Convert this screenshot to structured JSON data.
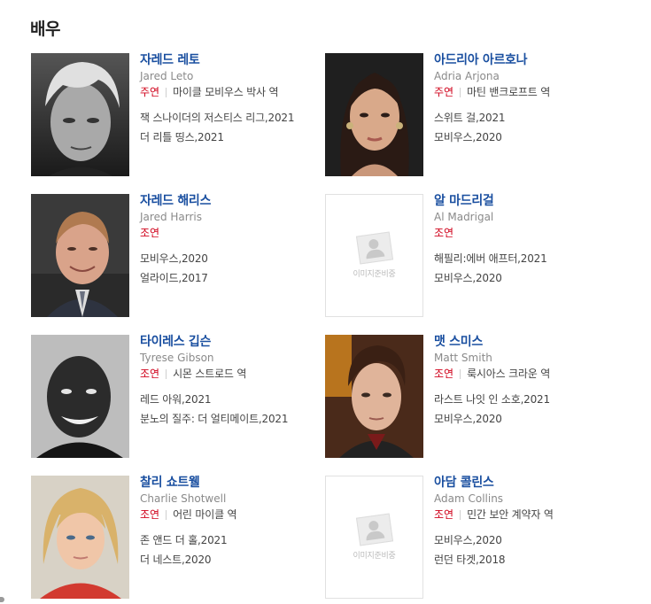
{
  "section": {
    "title": "배우"
  },
  "placeholder_text": "이미지준비중",
  "actors": [
    {
      "name": "자레드 레토",
      "eng": "Jared Leto",
      "type": "주연",
      "role": "마이클 모비우스 박사 역",
      "works": [
        "잭 스나이더의 저스티스 리그,2021",
        "더 리틀 띵스,2021"
      ]
    },
    {
      "name": "아드리아 아르호나",
      "eng": "Adria Arjona",
      "type": "주연",
      "role": "마틴 밴크로프트 역",
      "works": [
        "스위트 걸,2021",
        "모비우스,2020"
      ]
    },
    {
      "name": "자레드 해리스",
      "eng": "Jared Harris",
      "type": "조연",
      "role": "",
      "works": [
        "모비우스,2020",
        "얼라이드,2017"
      ]
    },
    {
      "name": "알 마드리걸",
      "eng": "Al Madrigal",
      "type": "조연",
      "role": "",
      "works": [
        "해필리:에버 애프터,2021",
        "모비우스,2020"
      ]
    },
    {
      "name": "타이레스 깁슨",
      "eng": "Tyrese Gibson",
      "type": "조연",
      "role": "시몬 스트로드 역",
      "works": [
        "레드 아워,2021",
        "분노의 질주: 더 얼티메이트,2021"
      ]
    },
    {
      "name": "맷 스미스",
      "eng": "Matt Smith",
      "type": "조연",
      "role": "룩시아스 크라운 역",
      "works": [
        "라스트 나잇 인 소호,2021",
        "모비우스,2020"
      ]
    },
    {
      "name": "찰리 쇼트웰",
      "eng": "Charlie Shotwell",
      "type": "조연",
      "role": "어린 마이클 역",
      "works": [
        "존 앤드 더 홀,2021",
        "더 네스트,2020"
      ]
    },
    {
      "name": "아담 콜린스",
      "eng": "Adam Collins",
      "type": "조연",
      "role": "민간 보안 계약자 역",
      "works": [
        "모비우스,2020",
        "런던 타겟,2018"
      ]
    }
  ]
}
